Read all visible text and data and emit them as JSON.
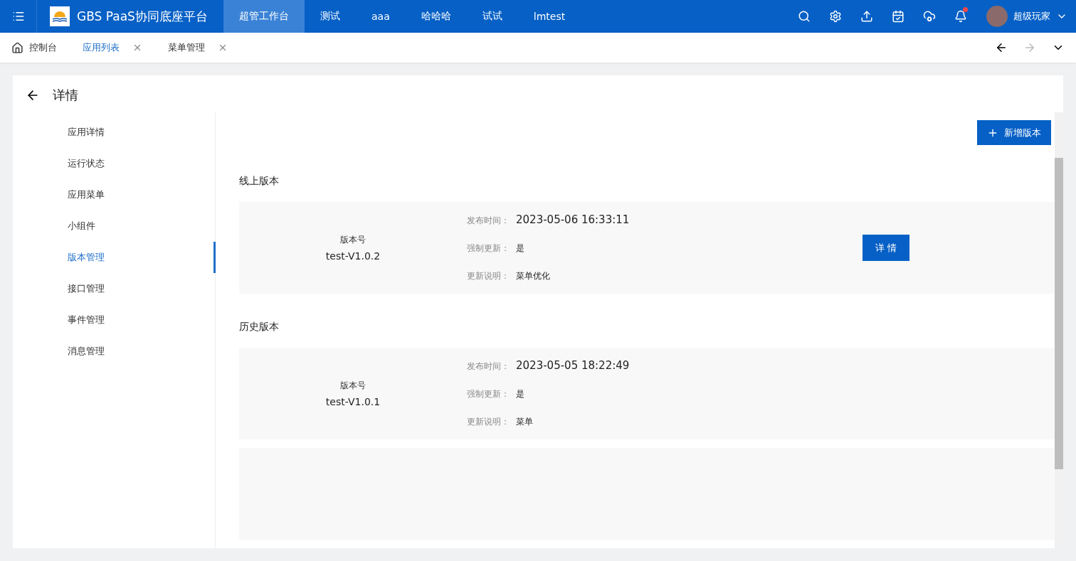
{
  "top_bar": {
    "brand": "GBS PaaS协同底座平台",
    "nav": [
      {
        "label": "超管工作台",
        "selected": true
      },
      {
        "label": "测试",
        "selected": false
      },
      {
        "label": "aaa",
        "selected": false
      },
      {
        "label": "哈哈哈",
        "selected": false
      },
      {
        "label": "试试",
        "selected": false
      },
      {
        "label": "lmtest",
        "selected": false
      }
    ],
    "notification_dot": true,
    "user": "超级玩家"
  },
  "tabs": [
    {
      "label": "控制台",
      "selected": false,
      "kind": "home"
    },
    {
      "label": "应用列表",
      "selected": true,
      "kind": "closable"
    },
    {
      "label": "菜单管理",
      "selected": false,
      "kind": "closable"
    }
  ],
  "page": {
    "title": "详情",
    "side_menu": [
      {
        "label": "应用详情",
        "selected": false
      },
      {
        "label": "运行状态",
        "selected": false
      },
      {
        "label": "应用菜单",
        "selected": false
      },
      {
        "label": "小组件",
        "selected": false
      },
      {
        "label": "版本管理",
        "selected": true
      },
      {
        "label": "接口管理",
        "selected": false
      },
      {
        "label": "事件管理",
        "selected": false
      },
      {
        "label": "消息管理",
        "selected": false
      }
    ],
    "add_button": "新增版本",
    "sections": [
      {
        "title": "线上版本",
        "versions": [
          {
            "version_label": "版本号",
            "version": "test-V1.0.2",
            "fields": [
              {
                "label": "发布时间：",
                "value": "2023-05-06 16:33:11",
                "kind": "large"
              },
              {
                "label": "强制更新：",
                "value": "是",
                "kind": "normal"
              },
              {
                "label": "更新说明：",
                "value": "菜单优化",
                "kind": "normal"
              }
            ],
            "action": "详 情"
          }
        ]
      },
      {
        "title": "历史版本",
        "versions": [
          {
            "version_label": "版本号",
            "version": "test-V1.0.1",
            "fields": [
              {
                "label": "发布时间：",
                "value": "2023-05-05 18:22:49",
                "kind": "large"
              },
              {
                "label": "强制更新：",
                "value": "是",
                "kind": "normal"
              },
              {
                "label": "更新说明：",
                "value": "菜单",
                "kind": "normal"
              }
            ]
          }
        ]
      }
    ]
  }
}
